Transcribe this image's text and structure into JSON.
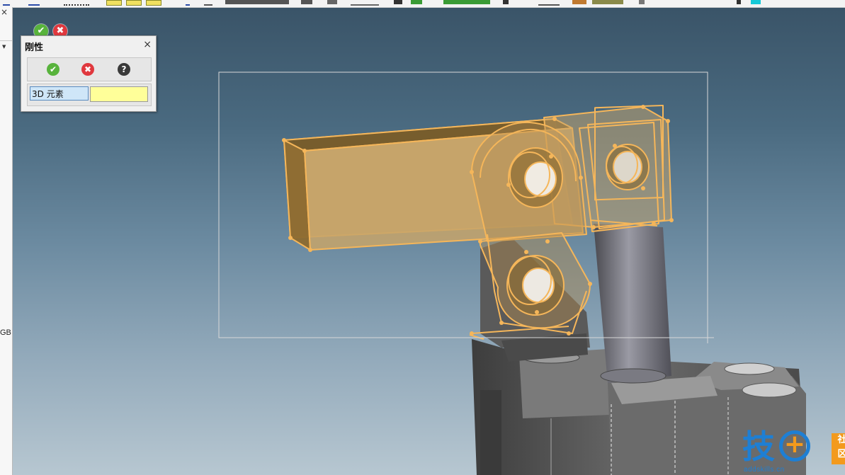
{
  "viewport": {
    "ok_glyph": "✔",
    "cancel_glyph": "✖",
    "ok_icon": "check-icon",
    "cancel_icon": "close-icon"
  },
  "left_panel": {
    "close_glyph": "×",
    "arrow_glyph": "▼",
    "label": "GB"
  },
  "dialog": {
    "title": "刚性",
    "close_glyph": "×",
    "buttons": {
      "ok_glyph": "✔",
      "cancel_glyph": "✖",
      "help_glyph": "?"
    },
    "field": {
      "label": "3D 元素",
      "value": ""
    }
  },
  "watermark": {
    "char": "技",
    "plus": "+",
    "box_top": "社",
    "box_bottom": "区",
    "url": "addskills.cn"
  },
  "colors": {
    "ok": "#58b33c",
    "cancel": "#e0383e",
    "help": "#3a3a3a",
    "highlight": "#f5b65a",
    "field_value_bg": "#ffff99",
    "logo_blue": "#1e7fd4",
    "logo_orange": "#f39a1d"
  }
}
